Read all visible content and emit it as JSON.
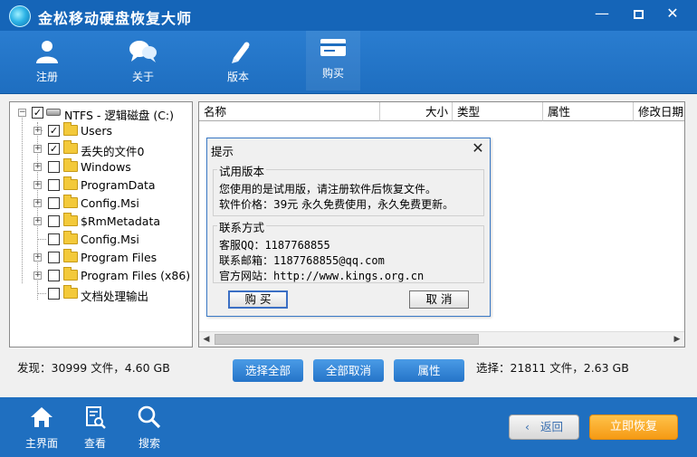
{
  "window": {
    "title": "金松移动硬盘恢复大师",
    "min_glyph": "—",
    "close_glyph": "✕"
  },
  "toolbar": {
    "items": [
      {
        "label": "注册",
        "icon": "register-icon"
      },
      {
        "label": "关于",
        "icon": "about-icon"
      },
      {
        "label": "版本",
        "icon": "version-icon"
      },
      {
        "label": "购买",
        "icon": "buy-icon"
      }
    ]
  },
  "tree": {
    "root": {
      "label": "NTFS - 逻辑磁盘 (C:)",
      "checked": true
    },
    "items": [
      {
        "label": "Users",
        "checked": true,
        "expandable": true
      },
      {
        "label": "丢失的文件0",
        "checked": true,
        "expandable": true
      },
      {
        "label": "Windows",
        "checked": false,
        "expandable": true
      },
      {
        "label": "ProgramData",
        "checked": false,
        "expandable": true
      },
      {
        "label": "Config.Msi",
        "checked": false,
        "expandable": true
      },
      {
        "label": "$RmMetadata",
        "checked": false,
        "expandable": true
      },
      {
        "label": "Config.Msi",
        "checked": false,
        "expandable": false
      },
      {
        "label": "Program Files",
        "checked": false,
        "expandable": true
      },
      {
        "label": "Program Files (x86)",
        "checked": false,
        "expandable": true
      },
      {
        "label": "文档处理输出",
        "checked": false,
        "expandable": false
      }
    ]
  },
  "filelist": {
    "columns": [
      "名称",
      "大小",
      "类型",
      "属性",
      "修改日期"
    ]
  },
  "dialog": {
    "title": "提示",
    "trial_group": {
      "title": "试用版本",
      "line1": "您使用的是试用版，请注册软件后恢复文件。",
      "line2": "软件价格：39元 永久免费使用，永久免费更新。"
    },
    "contact_group": {
      "title": "联系方式",
      "qq": "客服QQ：1187768855",
      "email": "联系邮箱：1187768855@qq.com",
      "website": "官方网站：http://www.kings.org.cn"
    },
    "buy_label": "购 买",
    "cancel_label": "取 消"
  },
  "status": {
    "found": "发现：30999 文件，4.60 GB",
    "selected": "选择：21811 文件，2.63 GB"
  },
  "actions": {
    "select_all": "选择全部",
    "deselect_all": "全部取消",
    "properties": "属性"
  },
  "bottombar": {
    "home": "主界面",
    "view": "查看",
    "search": "搜索",
    "back": "返回",
    "start": "立即恢复"
  },
  "colors": {
    "titlebar": "#1565b8",
    "toolbar": "#1f6fc0",
    "action_button": "#2f82d6",
    "start_button": "#f5a623"
  }
}
